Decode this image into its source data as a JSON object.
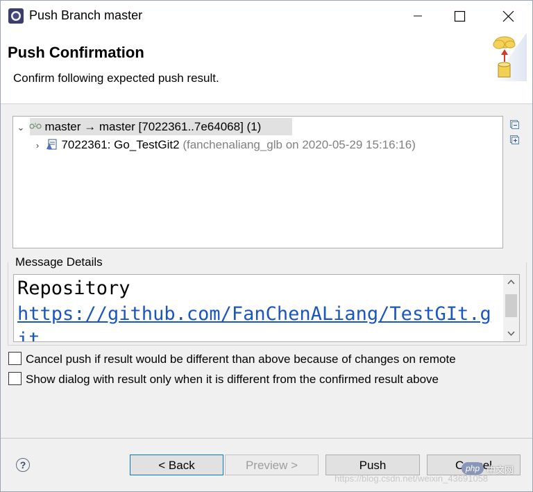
{
  "window": {
    "title": "Push Branch master"
  },
  "banner": {
    "title": "Push Confirmation",
    "description": "Confirm following expected push result."
  },
  "tree": {
    "ref": {
      "label": "master → master [7022361..7e64068] (1)"
    },
    "commit": {
      "label": "7022361: Go_TestGit2",
      "meta": "(fanchenaliang_glb on 2020-05-29 15:16:16)"
    }
  },
  "details": {
    "group_label": "Message Details",
    "heading": "Repository",
    "url": "https://github.com/FanChenALiang/TestGIt.git"
  },
  "options": {
    "cancel_if_different": "Cancel push if result would be different than above because of changes on remote",
    "show_only_if_different": "Show dialog with result only when it is different from the confirmed result above"
  },
  "buttons": {
    "help": "?",
    "back": "< Back",
    "preview": "Preview >",
    "push": "Push",
    "cancel": "Cancel"
  },
  "watermark": {
    "text": "https://blog.csdn.net/weixin_43691058",
    "badge": "php",
    "badge_cn": "中文网"
  }
}
